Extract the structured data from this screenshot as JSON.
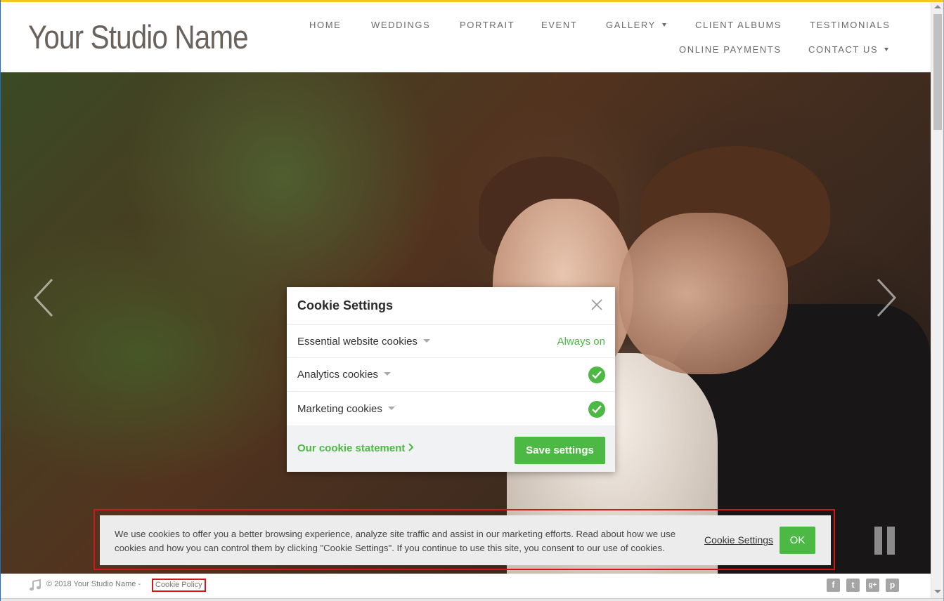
{
  "site": {
    "logo": "Your Studio Name",
    "accent_color": "#f2c81f"
  },
  "nav": {
    "home": "HOME",
    "weddings": "WEDDINGS",
    "portrait": "PORTRAIT",
    "event": "EVENT",
    "gallery": "GALLERY",
    "client_albums": "CLIENT ALBUMS",
    "testimonials": "TESTIMONIALS",
    "online_payments": "ONLINE PAYMENTS",
    "contact_us": "CONTACT US"
  },
  "modal": {
    "title": "Cookie Settings",
    "rows": [
      {
        "label": "Essential website cookies",
        "status": "Always on"
      },
      {
        "label": "Analytics cookies",
        "checked": true
      },
      {
        "label": "Marketing cookies",
        "checked": true
      }
    ],
    "statement_link": "Our cookie statement",
    "save_button": "Save settings",
    "accent_color": "#4cb944"
  },
  "banner": {
    "text": "We use cookies to offer you a better browsing experience, analyze site traffic and assist in our marketing efforts. Read about how we use cookies and how you can control them by clicking \"Cookie Settings\". If you continue to use this site, you consent to our use of cookies.",
    "settings_link": "Cookie Settings",
    "ok_button": "OK"
  },
  "footer": {
    "copyright": "© 2018 Your Studio Name  -",
    "policy_link": "Cookie Policy",
    "social_icons": [
      "facebook-icon",
      "twitter-icon",
      "google-plus-icon",
      "pinterest-icon"
    ]
  }
}
